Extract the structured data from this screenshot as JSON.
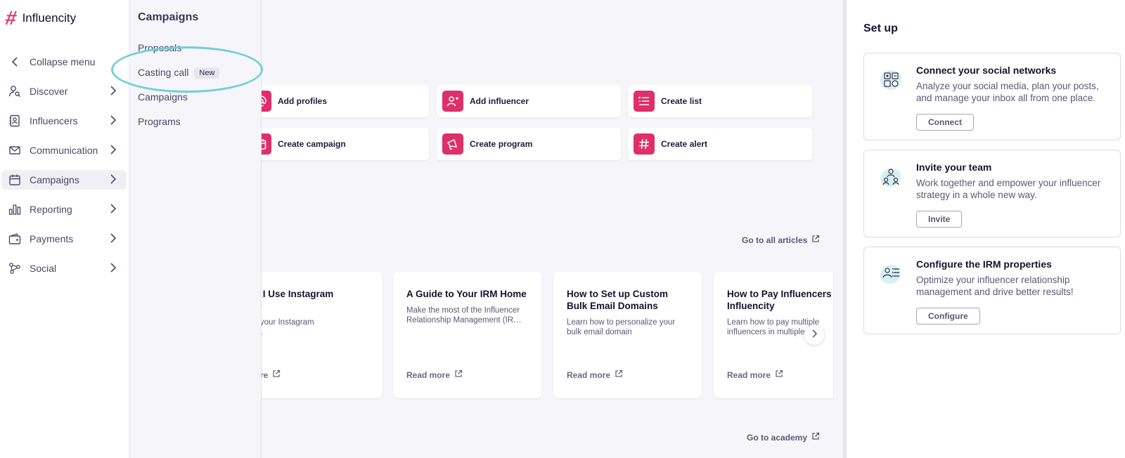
{
  "brand": {
    "name": "Influencity",
    "accent": "#e0366b"
  },
  "nav": {
    "collapse_label": "Collapse menu",
    "items": [
      {
        "label": "Discover",
        "icon": "user-search-icon"
      },
      {
        "label": "Influencers",
        "icon": "contacts-icon"
      },
      {
        "label": "Communication",
        "icon": "mail-icon"
      },
      {
        "label": "Campaigns",
        "icon": "calendar-icon",
        "active": true
      },
      {
        "label": "Reporting",
        "icon": "bar-chart-icon"
      },
      {
        "label": "Payments",
        "icon": "wallet-icon"
      },
      {
        "label": "Social",
        "icon": "share-nodes-icon"
      }
    ]
  },
  "submenu": {
    "title": "Campaigns",
    "items": [
      {
        "label": "Proposals"
      },
      {
        "label": "Casting call",
        "badge": "New"
      },
      {
        "label": "Campaigns"
      },
      {
        "label": "Programs"
      }
    ]
  },
  "quick_actions": [
    {
      "label": "Add profiles",
      "icon": "at-sign-icon"
    },
    {
      "label": "Add influencer",
      "icon": "user-plus-icon"
    },
    {
      "label": "Create list",
      "icon": "list-icon"
    },
    {
      "label": "Create campaign",
      "icon": "calendar-icon"
    },
    {
      "label": "Create program",
      "icon": "megaphone-icon"
    },
    {
      "label": "Create alert",
      "icon": "hashtag-icon"
    }
  ],
  "articles_section": {
    "all_articles_link": "Go to all articles",
    "items": [
      {
        "title": "Do I Use Instagram\nrs?",
        "desc": "ize your Instagram\nhes.",
        "read": "more"
      },
      {
        "title": "A Guide to Your IRM Home",
        "desc": "Make the most of the Influencer\nRelationship Management (IR…",
        "read": "Read more"
      },
      {
        "title": "How to Set up Custom\nBulk Email Domains",
        "desc": "Learn how to personalize your\nbulk email domain",
        "read": "Read more"
      },
      {
        "title": "How to Pay Influencers\nInfluencity",
        "desc": "Learn how to pay multiple\ninfluencers in multiple",
        "read": "Read more"
      }
    ],
    "academy_link": "Go to academy"
  },
  "setup": {
    "title": "Set up",
    "cards": [
      {
        "title": "Connect your social networks",
        "desc": "Analyze your social media, plan your posts, and manage your inbox all from one place.",
        "button": "Connect",
        "icon": "social-network-icon"
      },
      {
        "title": "Invite your team",
        "desc": "Work together and empower your influencer strategy in a whole new way.",
        "button": "Invite",
        "icon": "team-icon"
      },
      {
        "title": "Configure the IRM properties",
        "desc": "Optimize your influencer relationship management and drive better results!",
        "button": "Configure",
        "icon": "irm-properties-icon"
      }
    ]
  }
}
